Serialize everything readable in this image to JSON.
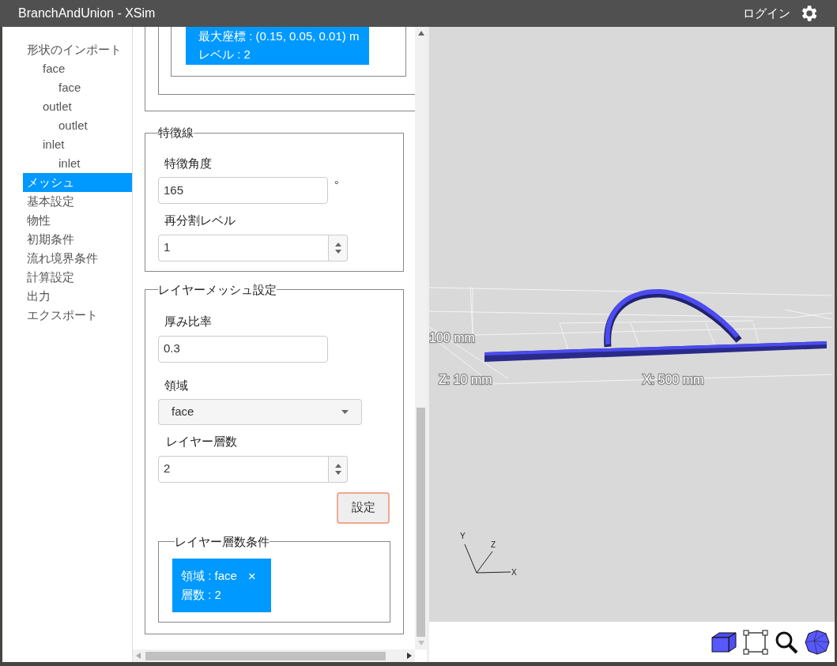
{
  "window": {
    "title": "BranchAndUnion - XSim",
    "login": "ログイン"
  },
  "sidebar": {
    "items": [
      {
        "label": "形状のインポート",
        "selected": false,
        "children": [
          {
            "label": "face",
            "selected": false,
            "children": [
              {
                "label": "face",
                "selected": false
              }
            ]
          },
          {
            "label": "outlet",
            "selected": false,
            "children": [
              {
                "label": "outlet",
                "selected": false
              }
            ]
          },
          {
            "label": "inlet",
            "selected": false,
            "children": [
              {
                "label": "inlet",
                "selected": false
              }
            ]
          }
        ]
      },
      {
        "label": "メッシュ",
        "selected": true
      },
      {
        "label": "基本設定",
        "selected": false
      },
      {
        "label": "物性",
        "selected": false
      },
      {
        "label": "初期条件",
        "selected": false
      },
      {
        "label": "流れ境界条件",
        "selected": false
      },
      {
        "label": "計算設定",
        "selected": false
      },
      {
        "label": "出力",
        "selected": false
      },
      {
        "label": "エクスポート",
        "selected": false
      }
    ]
  },
  "refinement": {
    "lines": [
      "最大座標 : (0.15, 0.05, 0.01) m",
      "レベル : 2"
    ]
  },
  "feature_lines": {
    "legend": "特徴線",
    "angle_label": "特徴角度",
    "angle_value": "165",
    "angle_unit": "°",
    "level_label": "再分割レベル",
    "level_value": "1"
  },
  "layer_mesh": {
    "legend": "レイヤーメッシュ設定",
    "ratio_label": "厚み比率",
    "ratio_value": "0.3",
    "region_label": "領域",
    "region_value": "face",
    "count_label": "レイヤー層数",
    "count_value": "2",
    "set_button": "設定",
    "conditions": {
      "legend": "レイヤー層数条件",
      "items": [
        {
          "region": "領域 : face",
          "count": "層数 : 2",
          "remove": "×"
        }
      ]
    }
  },
  "viewport": {
    "dimension_labels": [
      "100 mm",
      "Z: 10 mm",
      "X: 500 mm"
    ],
    "axes": [
      "Y",
      "Z",
      "X"
    ]
  }
}
